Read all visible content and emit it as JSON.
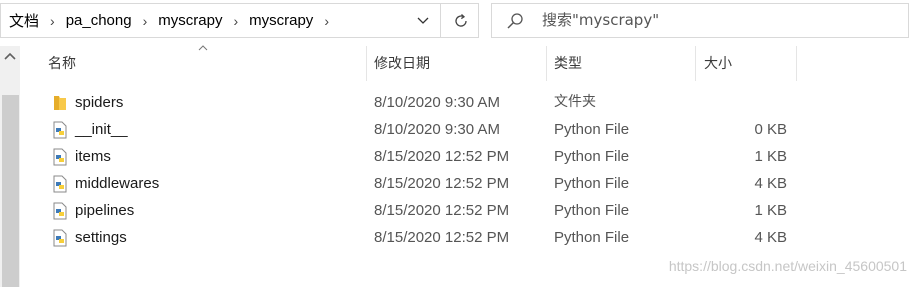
{
  "address_bar": {
    "breadcrumbs": [
      "文档",
      "pa_chong",
      "myscrapy",
      "myscrapy"
    ]
  },
  "search": {
    "placeholder": "搜索\"myscrapy\""
  },
  "columns": {
    "name": "名称",
    "date": "修改日期",
    "type": "类型",
    "size": "大小"
  },
  "files": [
    {
      "icon": "folder-icon",
      "name": "spiders",
      "date": "8/10/2020 9:30 AM",
      "type": "文件夹",
      "size": ""
    },
    {
      "icon": "python-file-icon",
      "name": "__init__",
      "date": "8/10/2020 9:30 AM",
      "type": "Python File",
      "size": "0 KB"
    },
    {
      "icon": "python-file-icon",
      "name": "items",
      "date": "8/15/2020 12:52 PM",
      "type": "Python File",
      "size": "1 KB"
    },
    {
      "icon": "python-file-icon",
      "name": "middlewares",
      "date": "8/15/2020 12:52 PM",
      "type": "Python File",
      "size": "4 KB"
    },
    {
      "icon": "python-file-icon",
      "name": "pipelines",
      "date": "8/15/2020 12:52 PM",
      "type": "Python File",
      "size": "1 KB"
    },
    {
      "icon": "python-file-icon",
      "name": "settings",
      "date": "8/15/2020 12:52 PM",
      "type": "Python File",
      "size": "4 KB"
    }
  ],
  "watermark": "https://blog.csdn.net/weixin_45600501",
  "colors": {
    "folder": "#f8c94a",
    "python_blue": "#3d7ab8",
    "python_yellow": "#f7cf3a"
  }
}
